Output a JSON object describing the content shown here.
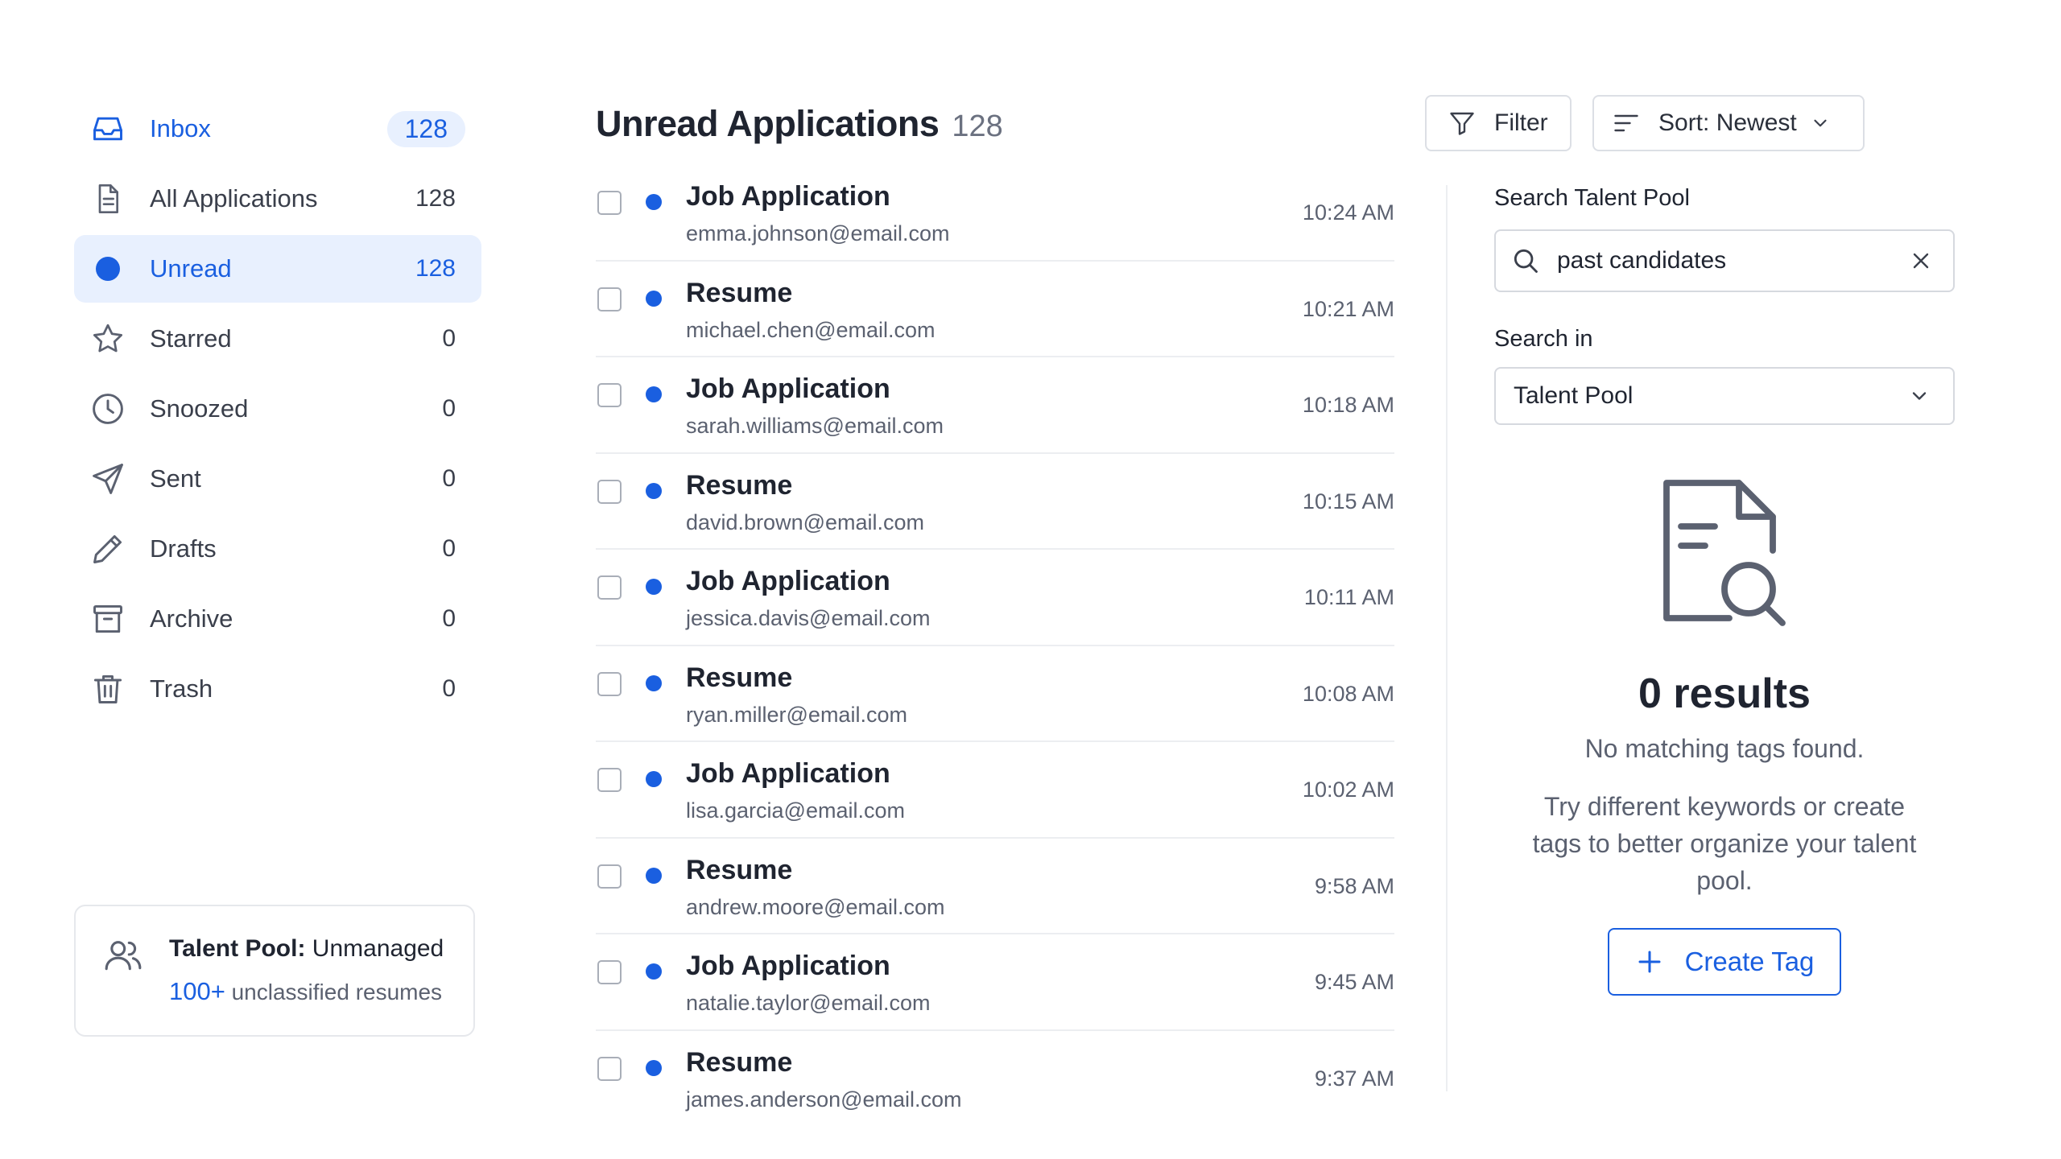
{
  "sidebar": {
    "items": [
      {
        "label": "Inbox",
        "count": "128"
      },
      {
        "label": "All Applications",
        "count": "128"
      },
      {
        "label": "Unread",
        "count": "128"
      },
      {
        "label": "Starred",
        "count": "0"
      },
      {
        "label": "Snoozed",
        "count": "0"
      },
      {
        "label": "Sent",
        "count": "0"
      },
      {
        "label": "Drafts",
        "count": "0"
      },
      {
        "label": "Archive",
        "count": "0"
      },
      {
        "label": "Trash",
        "count": "0"
      }
    ],
    "talent_pool_card": {
      "title": "Talent Pool:",
      "status": "Unmanaged",
      "count": "100+",
      "sub": "unclassified resumes"
    }
  },
  "main": {
    "title": "Unread Applications",
    "count": "128",
    "filter_label": "Filter",
    "sort_label": "Sort: Newest",
    "rows": [
      {
        "subject": "Job Application",
        "from": "emma.johnson@email.com",
        "time": "10:24 AM"
      },
      {
        "subject": "Resume",
        "from": "michael.chen@email.com",
        "time": "10:21 AM"
      },
      {
        "subject": "Job Application",
        "from": "sarah.williams@email.com",
        "time": "10:18 AM"
      },
      {
        "subject": "Resume",
        "from": "david.brown@email.com",
        "time": "10:15 AM"
      },
      {
        "subject": "Job Application",
        "from": "jessica.davis@email.com",
        "time": "10:11 AM"
      },
      {
        "subject": "Resume",
        "from": "ryan.miller@email.com",
        "time": "10:08 AM"
      },
      {
        "subject": "Job Application",
        "from": "lisa.garcia@email.com",
        "time": "10:02 AM"
      },
      {
        "subject": "Resume",
        "from": "andrew.moore@email.com",
        "time": "9:58 AM"
      },
      {
        "subject": "Job Application",
        "from": "natalie.taylor@email.com",
        "time": "9:45 AM"
      },
      {
        "subject": "Resume",
        "from": "james.anderson@email.com",
        "time": "9:37 AM"
      }
    ]
  },
  "search_panel": {
    "search_label": "Search Talent Pool",
    "search_value": "past candidates",
    "search_in_label": "Search in",
    "search_in_value": "Talent Pool",
    "results_title": "0 results",
    "results_sub": "No matching tags found.",
    "hint": "Try different keywords or create tags to better organize your talent pool.",
    "create_label": "Create Tag"
  },
  "colors": {
    "accent": "#1a5fe0",
    "active_bg": "#e8f0fe",
    "text": "#1f2430",
    "muted": "#5b6170",
    "border": "#dcdfe5"
  }
}
